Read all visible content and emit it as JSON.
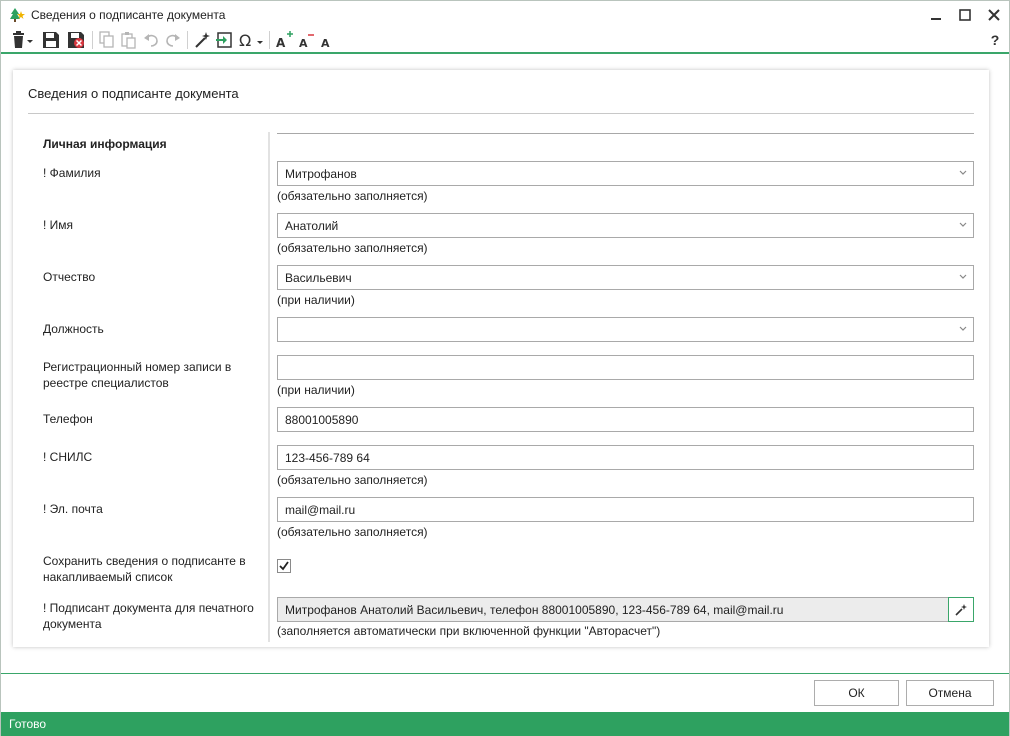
{
  "window": {
    "title": "Сведения о подписанте документа",
    "help_label": "?"
  },
  "card": {
    "title": "Сведения о подписанте документа",
    "section_title": "Личная информация"
  },
  "fields": {
    "lastname": {
      "label": "! Фамилия",
      "value": "Митрофанов",
      "hint": "(обязательно заполняется)"
    },
    "firstname": {
      "label": "! Имя",
      "value": "Анатолий",
      "hint": "(обязательно заполняется)"
    },
    "patronymic": {
      "label": "Отчество",
      "value": "Васильевич",
      "hint": "(при наличии)"
    },
    "position": {
      "label": "Должность",
      "value": ""
    },
    "regnum": {
      "label": "Регистрационный номер записи в реестре специалистов",
      "value": "",
      "hint": "(при наличии)"
    },
    "phone": {
      "label": "Телефон",
      "value": "88001005890"
    },
    "snils": {
      "label": "! СНИЛС",
      "value": "123-456-789 64",
      "hint": "(обязательно заполняется)"
    },
    "email": {
      "label": "! Эл. почта",
      "value": "mail@mail.ru",
      "hint": "(обязательно заполняется)"
    },
    "save": {
      "label": "Сохранить сведения о подписанте в накапливаемый список",
      "checked": true
    },
    "signer": {
      "label": "! Подписант документа для печатного документа",
      "value": "Митрофанов Анатолий Васильевич, телефон 88001005890, 123-456-789 64, mail@mail.ru",
      "hint": "(заполняется автоматически при включенной функции \"Авторасчет\")"
    }
  },
  "buttons": {
    "ok": "ОК",
    "cancel": "Отмена"
  },
  "status": "Готово",
  "colors": {
    "accent": "#2ea160",
    "line": "#3aa66a"
  }
}
